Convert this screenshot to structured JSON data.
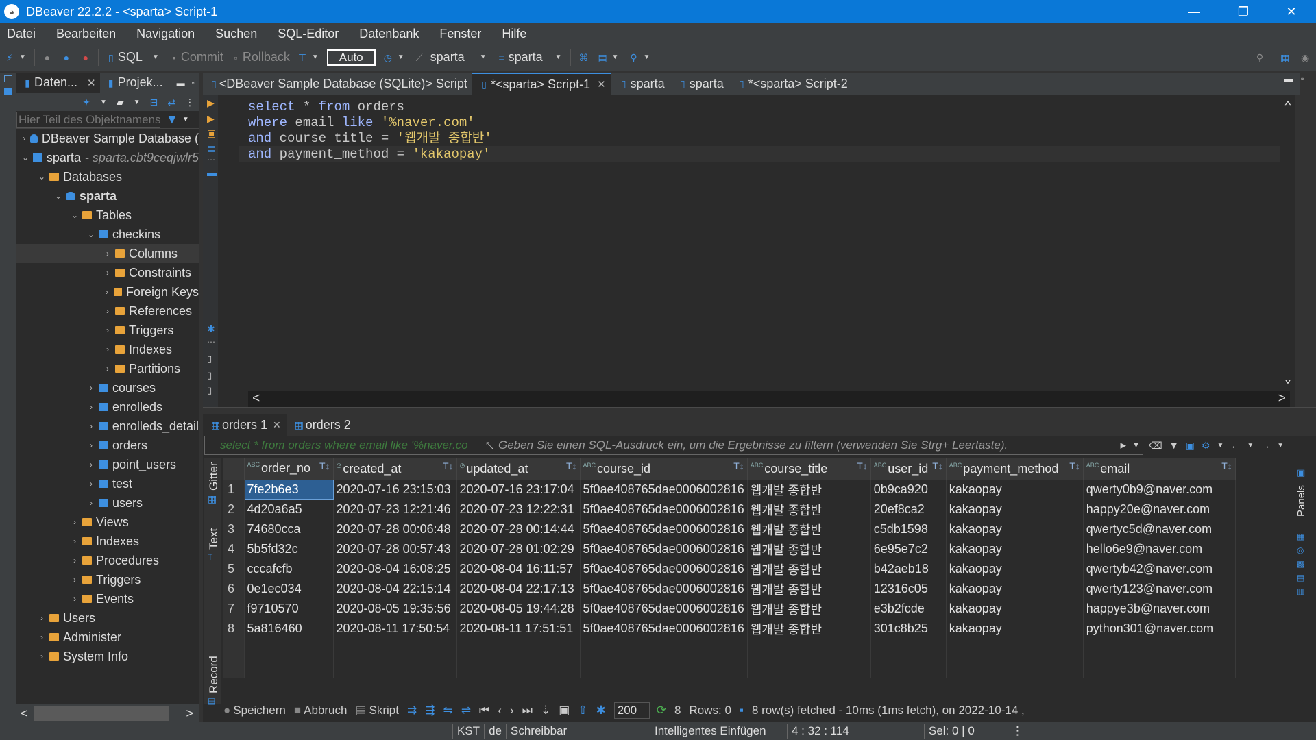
{
  "window": {
    "title": "DBeaver 22.2.2 - <sparta> Script-1"
  },
  "menu": [
    "Datei",
    "Bearbeiten",
    "Navigation",
    "Suchen",
    "SQL-Editor",
    "Datenbank",
    "Fenster",
    "Hilfe"
  ],
  "toolbar": {
    "sql": "SQL",
    "commit": "Commit",
    "rollback": "Rollback",
    "auto": "Auto",
    "datasource": "sparta",
    "schema": "sparta"
  },
  "left_panel": {
    "tab_db": "Daten...",
    "tab_proj": "Projek...",
    "filter_placeholder": "Hier Teil des Objektnamens",
    "tree": [
      {
        "label": "DBeaver Sample Database (",
        "depth": 0,
        "twisty": ">",
        "icon": "db"
      },
      {
        "label": "sparta",
        "extra": "- sparta.cbt9ceqjwlr5",
        "depth": 0,
        "twisty": "v",
        "icon": "conn"
      },
      {
        "label": "Databases",
        "depth": 1,
        "twisty": "v",
        "icon": "folder"
      },
      {
        "label": "sparta",
        "depth": 2,
        "twisty": "v",
        "icon": "db",
        "bold": true
      },
      {
        "label": "Tables",
        "depth": 3,
        "twisty": "v",
        "icon": "folder"
      },
      {
        "label": "checkins",
        "depth": 4,
        "twisty": "v",
        "icon": "table"
      },
      {
        "label": "Columns",
        "depth": 5,
        "twisty": ">",
        "icon": "folder",
        "selected": true
      },
      {
        "label": "Constraints",
        "depth": 5,
        "twisty": ">",
        "icon": "folder"
      },
      {
        "label": "Foreign Keys",
        "depth": 5,
        "twisty": ">",
        "icon": "folder"
      },
      {
        "label": "References",
        "depth": 5,
        "twisty": ">",
        "icon": "folder"
      },
      {
        "label": "Triggers",
        "depth": 5,
        "twisty": ">",
        "icon": "folder"
      },
      {
        "label": "Indexes",
        "depth": 5,
        "twisty": ">",
        "icon": "folder"
      },
      {
        "label": "Partitions",
        "depth": 5,
        "twisty": ">",
        "icon": "folder"
      },
      {
        "label": "courses",
        "depth": 4,
        "twisty": ">",
        "icon": "table"
      },
      {
        "label": "enrolleds",
        "depth": 4,
        "twisty": ">",
        "icon": "table"
      },
      {
        "label": "enrolleds_detail",
        "depth": 4,
        "twisty": ">",
        "icon": "table"
      },
      {
        "label": "orders",
        "depth": 4,
        "twisty": ">",
        "icon": "table"
      },
      {
        "label": "point_users",
        "depth": 4,
        "twisty": ">",
        "icon": "table"
      },
      {
        "label": "test",
        "depth": 4,
        "twisty": ">",
        "icon": "table"
      },
      {
        "label": "users",
        "depth": 4,
        "twisty": ">",
        "icon": "table"
      },
      {
        "label": "Views",
        "depth": 3,
        "twisty": ">",
        "icon": "folder"
      },
      {
        "label": "Indexes",
        "depth": 3,
        "twisty": ">",
        "icon": "folder"
      },
      {
        "label": "Procedures",
        "depth": 3,
        "twisty": ">",
        "icon": "folder"
      },
      {
        "label": "Triggers",
        "depth": 3,
        "twisty": ">",
        "icon": "folder"
      },
      {
        "label": "Events",
        "depth": 3,
        "twisty": ">",
        "icon": "folder"
      },
      {
        "label": "Users",
        "depth": 1,
        "twisty": ">",
        "icon": "folder"
      },
      {
        "label": "Administer",
        "depth": 1,
        "twisty": ">",
        "icon": "folder"
      },
      {
        "label": "System Info",
        "depth": 1,
        "twisty": ">",
        "icon": "folder"
      }
    ]
  },
  "editor_tabs": [
    {
      "label": "<DBeaver Sample Database (SQLite)> Script",
      "active": false
    },
    {
      "label": "*<sparta> Script-1",
      "active": true,
      "closable": true
    },
    {
      "label": "sparta",
      "active": false
    },
    {
      "label": "sparta",
      "active": false
    },
    {
      "label": "*<sparta> Script-2",
      "active": false
    }
  ],
  "sql_lines": [
    [
      {
        "t": "select",
        "c": "kw"
      },
      {
        "t": " * ",
        "c": "plain"
      },
      {
        "t": "from",
        "c": "kw"
      },
      {
        "t": " orders",
        "c": "plain"
      }
    ],
    [
      {
        "t": "where",
        "c": "kw"
      },
      {
        "t": " email ",
        "c": "plain"
      },
      {
        "t": "like",
        "c": "kw"
      },
      {
        "t": " ",
        "c": "plain"
      },
      {
        "t": "'%naver.com'",
        "c": "str"
      }
    ],
    [
      {
        "t": "and",
        "c": "kw"
      },
      {
        "t": " course_title = ",
        "c": "plain"
      },
      {
        "t": "'웹개발 종합반'",
        "c": "str"
      }
    ],
    [
      {
        "t": "and",
        "c": "kw"
      },
      {
        "t": " payment_method = ",
        "c": "plain"
      },
      {
        "t": "'kakaopay'",
        "c": "str"
      }
    ]
  ],
  "results": {
    "tabs": [
      {
        "label": "orders 1",
        "active": true
      },
      {
        "label": "orders 2",
        "active": false
      }
    ],
    "filter_sql": "select * from orders where email like '%naver.co",
    "filter_hint": "Geben Sie einen SQL-Ausdruck ein, um die Ergebnisse zu filtern (verwenden Sie Strg+ Leertaste).",
    "side_tabs": [
      "Gitter",
      "Text",
      "Record"
    ],
    "right_side": "Panels",
    "columns": [
      "order_no",
      "created_at",
      "updated_at",
      "course_id",
      "course_title",
      "user_id",
      "payment_method",
      "email"
    ],
    "rows": [
      [
        "7fe2b6e3",
        "2020-07-16 23:15:03",
        "2020-07-16 23:17:04",
        "5f0ae408765dae0006002816",
        "웹개발 종합반",
        "0b9ca920",
        "kakaopay",
        "qwerty0b9@naver.com"
      ],
      [
        "4d20a6a5",
        "2020-07-23 12:21:46",
        "2020-07-23 12:22:31",
        "5f0ae408765dae0006002816",
        "웹개발 종합반",
        "20ef8ca2",
        "kakaopay",
        "happy20e@naver.com"
      ],
      [
        "74680cca",
        "2020-07-28 00:06:48",
        "2020-07-28 00:14:44",
        "5f0ae408765dae0006002816",
        "웹개발 종합반",
        "c5db1598",
        "kakaopay",
        "qwertyc5d@naver.com"
      ],
      [
        "5b5fd32c",
        "2020-07-28 00:57:43",
        "2020-07-28 01:02:29",
        "5f0ae408765dae0006002816",
        "웹개발 종합반",
        "6e95e7c2",
        "kakaopay",
        "hello6e9@naver.com"
      ],
      [
        "cccafcfb",
        "2020-08-04 16:08:25",
        "2020-08-04 16:11:57",
        "5f0ae408765dae0006002816",
        "웹개발 종합반",
        "b42aeb18",
        "kakaopay",
        "qwertyb42@naver.com"
      ],
      [
        "0e1ec034",
        "2020-08-04 22:15:14",
        "2020-08-04 22:17:13",
        "5f0ae408765dae0006002816",
        "웹개발 종합반",
        "12316c05",
        "kakaopay",
        "qwerty123@naver.com"
      ],
      [
        "f9710570",
        "2020-08-05 19:35:56",
        "2020-08-05 19:44:28",
        "5f0ae408765dae0006002816",
        "웹개발 종합반",
        "e3b2fcde",
        "kakaopay",
        "happye3b@naver.com"
      ],
      [
        "5a816460",
        "2020-08-11 17:50:54",
        "2020-08-11 17:51:51",
        "5f0ae408765dae0006002816",
        "웹개발 종합반",
        "301c8b25",
        "kakaopay",
        "python301@naver.com"
      ]
    ],
    "status": {
      "save": "Speichern",
      "cancel": "Abbruch",
      "script": "Skript",
      "fetch_size": "200",
      "count": "8",
      "rows": "Rows: 0",
      "fetched": "8 row(s) fetched - 10ms (1ms fetch), on 2022-10-14 ,"
    }
  },
  "statusbar": {
    "tz": "KST",
    "lang": "de",
    "mode": "Schreibbar",
    "insert": "Intelligentes Einfügen",
    "pos": "4 : 32 : 114",
    "sel": "Sel: 0 | 0"
  }
}
